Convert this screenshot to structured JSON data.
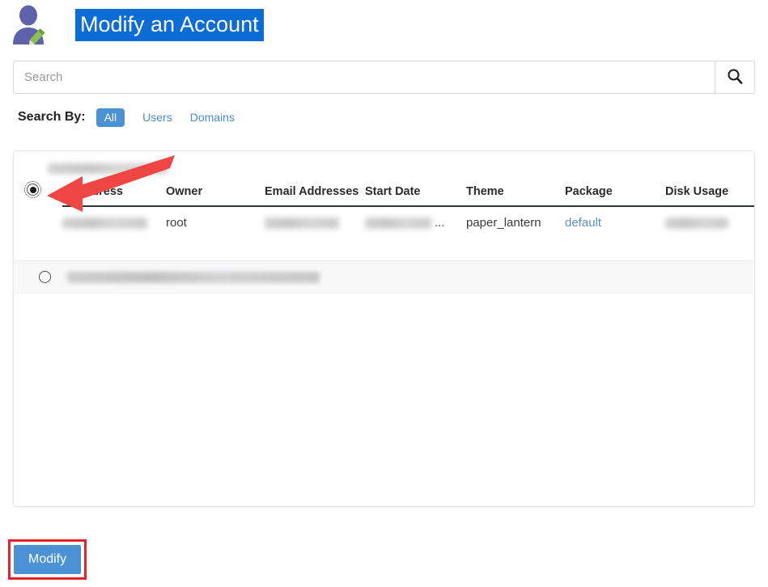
{
  "header": {
    "title": "Modify an Account",
    "avatar_icon": "user-edit-icon",
    "title_highlight_color": "#0a6cd4"
  },
  "search": {
    "placeholder": "Search",
    "value": "",
    "button_icon": "search-icon"
  },
  "search_by": {
    "label": "Search By:",
    "options": [
      {
        "label": "All",
        "active": true
      },
      {
        "label": "Users",
        "active": false
      },
      {
        "label": "Domains",
        "active": false
      }
    ],
    "active_color": "#4a92d3",
    "link_color": "#4a8ccc"
  },
  "table": {
    "group_label_redacted": "[redacted domain]",
    "columns": [
      "IP Address",
      "Owner",
      "Email Addresses",
      "Start Date",
      "Theme",
      "Package",
      "Disk Usage"
    ],
    "rows": [
      {
        "selected": true,
        "ip_address": "[redacted]",
        "owner": "root",
        "email_addresses": "[redacted]",
        "start_date": "[redacted]",
        "start_date_suffix": "...",
        "theme": "paper_lantern",
        "package": "default",
        "disk_usage": "[redacted]"
      },
      {
        "selected": false,
        "domain": "[redacted domain]"
      }
    ]
  },
  "footer": {
    "modify_label": "Modify",
    "modify_color": "#4a92d3",
    "annotation_color": "#e8202a"
  },
  "annotations": {
    "arrow": "red-arrow-pointing-to-selected-radio",
    "highlight_box": "red-box-around-modify-button"
  }
}
